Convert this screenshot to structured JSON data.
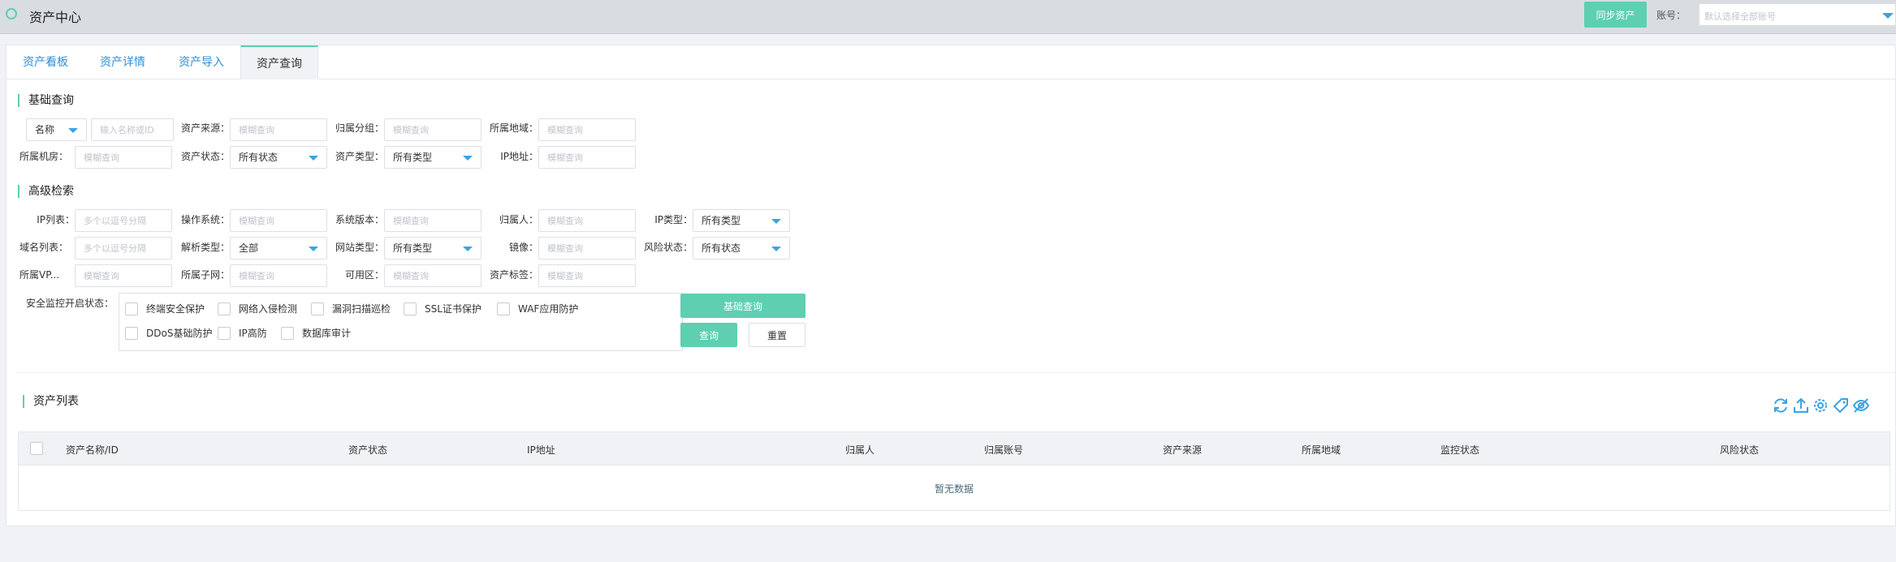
{
  "header": {
    "title": "资产中心",
    "sync_label": "同步资产",
    "account_label": "账号：",
    "account_placeholder": "默认选择全部账号"
  },
  "tabs": [
    "资产看板",
    "资产详情",
    "资产导入",
    "资产查询"
  ],
  "basic": {
    "title": "基础查询",
    "name_select": "名称",
    "name_placeholder": "输入名称或ID",
    "source_label": "资产来源：",
    "group_label": "归属分组：",
    "region_label": "所属地域：",
    "room_label": "所属机房：",
    "status_label": "资产状态：",
    "status_value": "所有状态",
    "type_label": "资产类型：",
    "type_value": "所有类型",
    "ip_label": "IP地址："
  },
  "advanced": {
    "title": "高级检索",
    "ip_list_label": "IP列表：",
    "ip_list_placeholder": "多个以逗号分隔",
    "os_label": "操作系统：",
    "os_version_label": "系统版本：",
    "owner_label": "归属人：",
    "ip_type_label": "IP类型：",
    "ip_type_value": "所有类型",
    "domain_label": "域名列表：",
    "domain_placeholder": "多个以逗号分隔",
    "resolve_label": "解析类型：",
    "resolve_value": "全部",
    "site_type_label": "网站类型：",
    "site_type_value": "所有类型",
    "mirror_label": "镜像：",
    "risk_label": "风险状态：",
    "risk_value": "所有状态",
    "vpc_label": "所属VP...",
    "subnet_label": "所属子网：",
    "zone_label": "可用区：",
    "tag_label": "资产标签：",
    "monitor_label": "安全监控开启状态：",
    "checkboxes": [
      "终端安全保护",
      "网络入侵检测",
      "漏洞扫描巡检",
      "SSL证书保护",
      "WAF应用防护",
      "DDoS基础防护",
      "IP高防",
      "数据库审计"
    ]
  },
  "fuzzy_placeholder": "模糊查询",
  "buttons": {
    "basic_query": "基础查询",
    "query": "查询",
    "reset": "重置"
  },
  "list": {
    "title": "资产列表",
    "columns": [
      "资产名称/ID",
      "资产状态",
      "IP地址",
      "归属人",
      "归属账号",
      "资产来源",
      "所属地域",
      "监控状态",
      "风险状态"
    ],
    "empty": "暂无数据"
  },
  "icons": [
    "refresh-icon",
    "upload-icon",
    "settings-icon",
    "tag-edit-icon",
    "hide-icon"
  ],
  "colors": {
    "accent": "#5ecfb1",
    "link": "#2f8fd8",
    "icon": "#3aa3e3"
  }
}
